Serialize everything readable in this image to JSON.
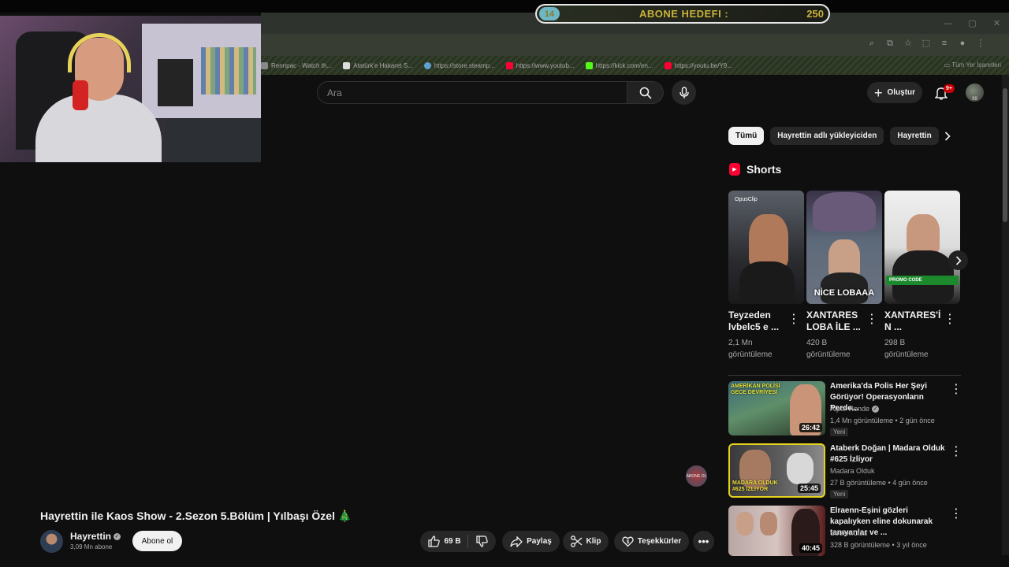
{
  "overlay": {
    "goal_label": "ABONE HEDEFI :",
    "goal_current": "14",
    "goal_target": "250"
  },
  "browser": {
    "bookmarks": [
      {
        "label": "Rennpac - Watch th...",
        "color": "#888888"
      },
      {
        "label": "Atatürk'e Hakaret S...",
        "color": "#dddddd"
      },
      {
        "label": "https://store.steamp...",
        "color": "#5fa0d0"
      },
      {
        "label": "https://www.youtub...",
        "color": "#ff0033"
      },
      {
        "label": "https://kick.com/en...",
        "color": "#53fc18"
      },
      {
        "label": "https://youtu.be/Y9...",
        "color": "#ff0033"
      }
    ],
    "all_bookmarks": "Tüm Yer İşaretleri"
  },
  "header": {
    "search_placeholder": "Ara",
    "create_label": "Oluştur",
    "notification_count": "9+",
    "avatar_text": "99"
  },
  "video": {
    "title": "Hayrettin ile Kaos Show - 2.Sezon 5.Bölüm | Yılbaşı Özel 🎄",
    "channel": "Hayrettin",
    "subscribers": "3,09 Mn abone",
    "subscribe_label": "Abone ol",
    "likes": "69 B",
    "share_label": "Paylaş",
    "clip_label": "Klip",
    "thanks_label": "Teşekkürler",
    "watermark": "ABONE OL"
  },
  "chips": [
    "Tümü",
    "Hayrettin adlı yükleyiciden",
    "Hayrettin"
  ],
  "shorts": {
    "heading": "Shorts",
    "items": [
      {
        "title": "Teyzeden lvbelc5 e ...",
        "views": "2,1 Mn görüntüleme",
        "badge": "OpusClip",
        "overlay": ""
      },
      {
        "title": "XANTARES LOBA İLE ...",
        "views": "420 B görüntüleme",
        "badge": "",
        "overlay": "NİCE LOBAAA"
      },
      {
        "title": "XANTARES'İ N ...",
        "views": "298 B görüntüleme",
        "badge": "",
        "overlay": "PROMO CODE"
      }
    ]
  },
  "recommendations": [
    {
      "title": "Amerika'da Polis Her Şeyi Görüyor! Operasyonların Perde...",
      "channel": "Alper Rende",
      "verified": true,
      "meta": "1,4 Mn görüntüleme • 2 gün önce",
      "badge": "Yeni",
      "duration": "26:42",
      "thumb_text": "AMERİKAN POLİSİ GECE DEVRİYESİ"
    },
    {
      "title": "Ataberk Doğan | Madara Olduk #625 İzliyor",
      "channel": "Madara Olduk",
      "verified": false,
      "meta": "27 B görüntüleme • 4 gün önce",
      "badge": "Yeni",
      "duration": "25:45",
      "thumb_text": "MADARA OLDUK #625 İZLİYOR"
    },
    {
      "title": "Elraenn-Eşini gözleri kapalıyken eline dokunarak tanıyanlar ve ...",
      "channel": "StreamCuts",
      "verified": false,
      "meta": "328 B görüntüleme • 3 yıl önce",
      "badge": "",
      "duration": "40:45",
      "thumb_text": ""
    }
  ]
}
